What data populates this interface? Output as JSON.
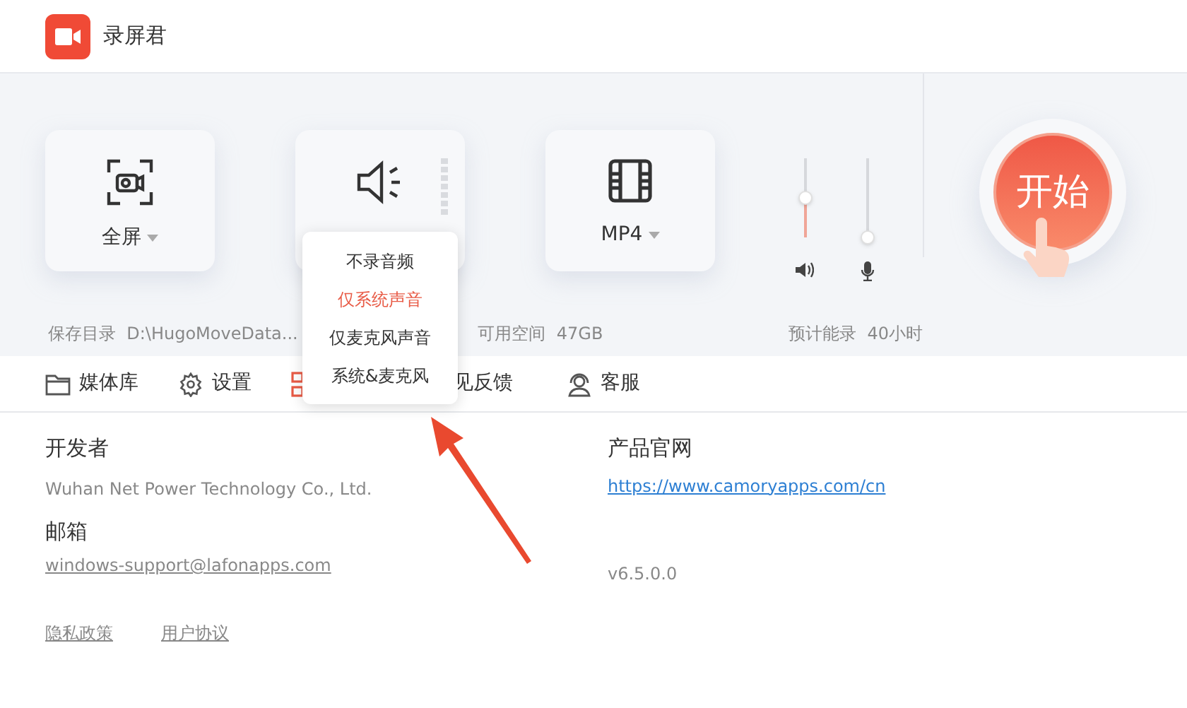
{
  "app": {
    "title": "录屏君"
  },
  "modes": [
    {
      "kind": "screen",
      "label": "全屏"
    },
    {
      "kind": "audio"
    },
    {
      "kind": "format",
      "label": "MP4"
    }
  ],
  "sliders": [
    {
      "kind": "speaker",
      "level": 0.5
    },
    {
      "kind": "mic",
      "level": 0
    }
  ],
  "start_button": {
    "label": "开始"
  },
  "info": [
    {
      "label": "保存目录",
      "value": "D:\\HugoMoveData..."
    },
    {
      "label": "可用空间",
      "value": "47GB"
    },
    {
      "label": "预计能录",
      "value": "40小时"
    }
  ],
  "nav": [
    {
      "kind": "folder",
      "label": "媒体库",
      "selected": false
    },
    {
      "kind": "gear",
      "label": "设置",
      "selected": false
    },
    {
      "kind": "grid",
      "selected": true
    },
    {
      "kind": "none",
      "label": "见反馈",
      "selected": false
    },
    {
      "kind": "headset",
      "label": "客服",
      "selected": false
    }
  ],
  "audio_menu": [
    {
      "label": "不录音频",
      "selected": false
    },
    {
      "label": "仅系统声音",
      "selected": true
    },
    {
      "label": "仅麦克风声音",
      "selected": false
    },
    {
      "label": "系统&麦克风",
      "selected": false
    }
  ],
  "about": {
    "developer_label": "开发者",
    "developer": "Wuhan Net Power Technology Co., Ltd.",
    "email_label": "邮箱",
    "email": "windows-support@lafonapps.com",
    "website_label": "产品官网",
    "website": "https://www.camoryapps.com/cn",
    "version": "v6.5.0.0",
    "links": [
      "隐私政策",
      "用户协议"
    ]
  }
}
